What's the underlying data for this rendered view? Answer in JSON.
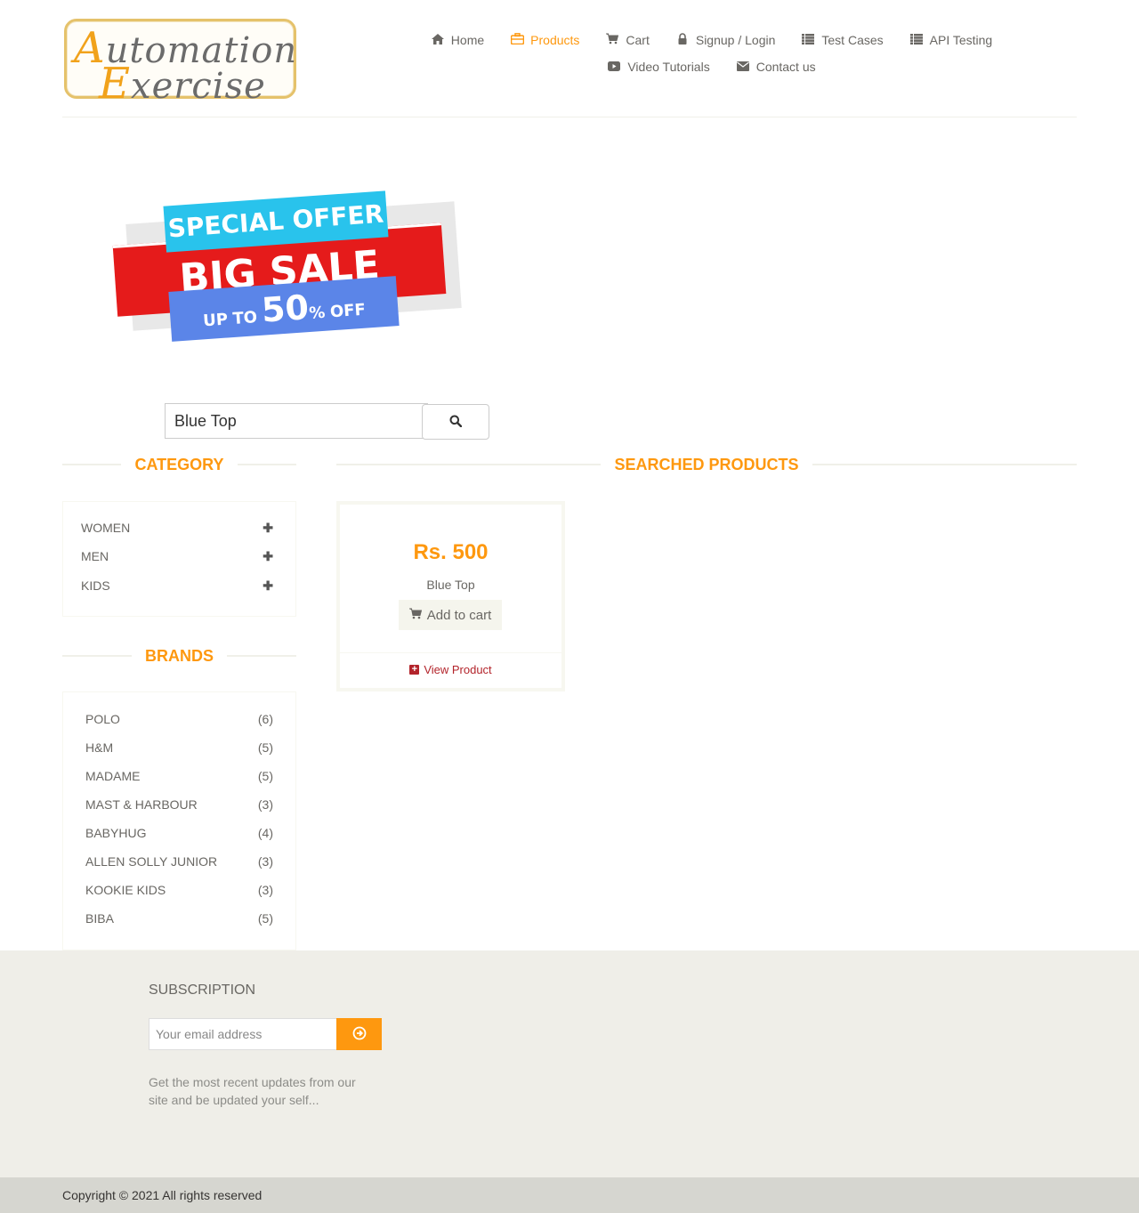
{
  "logo": {
    "line1_cap": "A",
    "line1_rest": "utomation",
    "line2_cap": "E",
    "line2_rest": "xercise"
  },
  "nav": {
    "row1": [
      {
        "label": "Home",
        "icon": "home-icon"
      },
      {
        "label": "Products",
        "icon": "briefcase-icon",
        "active": true
      },
      {
        "label": "Cart",
        "icon": "cart-icon"
      },
      {
        "label": "Signup / Login",
        "icon": "lock-icon"
      },
      {
        "label": "Test Cases",
        "icon": "list-icon"
      },
      {
        "label": "API Testing",
        "icon": "list-icon"
      }
    ],
    "row2": [
      {
        "label": "Video Tutorials",
        "icon": "youtube-play-icon"
      },
      {
        "label": "Contact us",
        "icon": "envelope-icon"
      }
    ]
  },
  "banner": {
    "top": "SPECIAL OFFER",
    "middle": "BIG SALE",
    "up": "UP",
    "to": "TO",
    "percent": "50",
    "pct_sign": "%",
    "off": "OFF"
  },
  "search": {
    "value": "Blue Top"
  },
  "category": {
    "title": "CATEGORY",
    "items": [
      "WOMEN",
      "MEN",
      "KIDS"
    ]
  },
  "brands": {
    "title": "BRANDS",
    "items": [
      {
        "name": "POLO",
        "count": "(6)"
      },
      {
        "name": "H&M",
        "count": "(5)"
      },
      {
        "name": "MADAME",
        "count": "(5)"
      },
      {
        "name": "MAST & HARBOUR",
        "count": "(3)"
      },
      {
        "name": "BABYHUG",
        "count": "(4)"
      },
      {
        "name": "ALLEN SOLLY JUNIOR",
        "count": "(3)"
      },
      {
        "name": "KOOKIE KIDS",
        "count": "(3)"
      },
      {
        "name": "BIBA",
        "count": "(5)"
      }
    ]
  },
  "results": {
    "title": "SEARCHED PRODUCTS",
    "product": {
      "price": "Rs. 500",
      "name": "Blue Top",
      "add_label": "Add to cart",
      "view_label": "View Product"
    }
  },
  "footer": {
    "subscription_title": "SUBSCRIPTION",
    "email_placeholder": "Your email address",
    "text": "Get the most recent updates from our site and be updated your self...",
    "copyright": "Copyright © 2021 All rights reserved"
  },
  "colors": {
    "accent": "#fe980f",
    "text": "#696763",
    "footer_bg": "#efeee8",
    "bottom_bg": "#d6d6d0",
    "view_link": "#b3242b"
  }
}
